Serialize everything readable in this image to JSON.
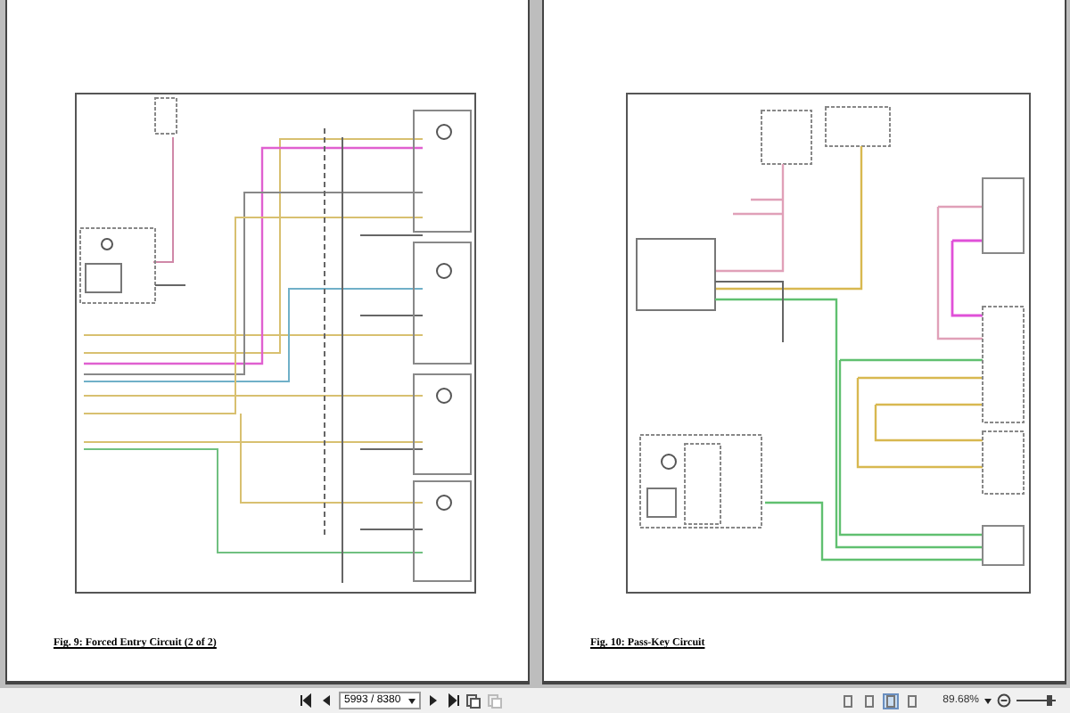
{
  "pages": [
    {
      "kind": "forced-entry",
      "caption": "Fig. 9: Forced Entry Circuit (2 of 2)"
    },
    {
      "kind": "pass-key",
      "caption": "Fig. 10: Pass-Key Circuit"
    }
  ],
  "toolbar": {
    "page_field": {
      "value": "5993 / 8380"
    },
    "zoom": "89.68%",
    "view_modes": [
      {
        "selected": false
      },
      {
        "selected": false
      },
      {
        "selected": true
      },
      {
        "selected": false
      }
    ]
  }
}
